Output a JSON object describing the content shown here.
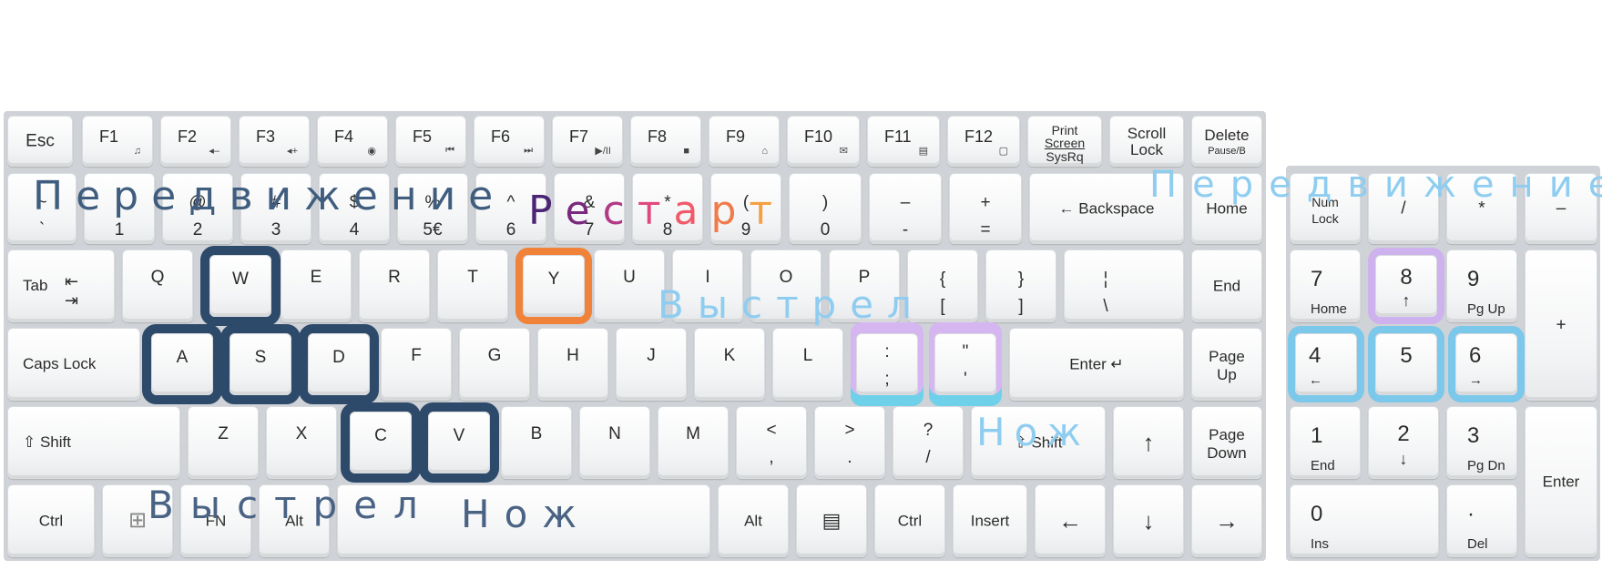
{
  "keyboard": {
    "fn_row": {
      "esc": "Esc",
      "f1": "F1",
      "f1_icon": "♫",
      "f2": "F2",
      "f2_icon": "◂–",
      "f3": "F3",
      "f3_icon": "◂+",
      "f4": "F4",
      "f4_icon": "◉",
      "f5": "F5",
      "f5_icon": "⏮",
      "f6": "F6",
      "f6_icon": "⏭",
      "f7": "F7",
      "f7_icon": "▶/II",
      "f8": "F8",
      "f8_icon": "■",
      "f9": "F9",
      "f9_icon": "⌂",
      "f10": "F10",
      "f10_icon": "✉",
      "f11": "F11",
      "f11_icon": "▤",
      "f12": "F12",
      "f12_icon": "▢",
      "print_screen_1": "Print",
      "print_screen_2": "Screen",
      "print_screen_3": "SysRq",
      "scroll_lock_1": "Scroll",
      "scroll_lock_2": "Lock",
      "delete": "Delete",
      "delete_alt": "Pause/B"
    },
    "num_row": {
      "tilde_top": "~",
      "tilde_bot": "`",
      "k1_top": "!",
      "k1_bot": "1",
      "k2_top": "@",
      "k2_bot": "2",
      "k3_top": "#",
      "k3_bot": "3",
      "k4_top": "$",
      "k4_bot": "4",
      "k5_top": "%",
      "k5_bot": "5€",
      "k6_top": "^",
      "k6_bot": "6",
      "k7_top": "&",
      "k7_bot": "7",
      "k8_top": "*",
      "k8_bot": "8",
      "k9_top": "(",
      "k9_bot": "9",
      "k0_top": ")",
      "k0_bot": "0",
      "minus_top": "–",
      "minus_bot": "-",
      "plus_top": "+",
      "plus_bot": "=",
      "backspace": "← Backspace",
      "home": "Home"
    },
    "top_row": {
      "tab": "Tab",
      "q": "Q",
      "w": "W",
      "e": "E",
      "r": "R",
      "t": "T",
      "y": "Y",
      "u": "U",
      "i": "I",
      "o": "O",
      "p": "P",
      "lbrace_top": "{",
      "lbrace_bot": "[",
      "rbrace_top": "}",
      "rbrace_bot": "]",
      "pipe_top": "¦",
      "pipe_bot": "\\",
      "end": "End"
    },
    "home_row": {
      "caps": "Caps Lock",
      "a": "A",
      "s": "S",
      "d": "D",
      "f": "F",
      "g": "G",
      "h": "H",
      "j": "J",
      "k": "K",
      "l": "L",
      "colon_top": ":",
      "colon_bot": ";",
      "quote_top": "\"",
      "quote_bot": "'",
      "enter": "Enter ↵",
      "pgup_1": "Page",
      "pgup_2": "Up"
    },
    "shift_row": {
      "shift_l": "⇧ Shift",
      "z": "Z",
      "x": "X",
      "c": "C",
      "v": "V",
      "b": "B",
      "n": "N",
      "m": "M",
      "lt_top": "<",
      "lt_bot": ",",
      "gt_top": ">",
      "gt_bot": ".",
      "q_top": "?",
      "q_bot": "/",
      "shift_r": "⇧ Shift",
      "up": "↑",
      "pgdn_1": "Page",
      "pgdn_2": "Down"
    },
    "bottom_row": {
      "ctrl_l": "Ctrl",
      "win": "⊞",
      "fn": "FN",
      "alt_l": "Alt",
      "alt_r": "Alt",
      "menu": "▤",
      "ctrl_r": "Ctrl",
      "insert": "Insert",
      "left": "←",
      "down": "↓",
      "right": "→"
    },
    "numpad": {
      "numlock_1": "Num",
      "numlock_2": "Lock",
      "slash": "/",
      "star": "*",
      "minus": "–",
      "n7": "7",
      "n7_alt": "Home",
      "n8": "8",
      "n8_alt": "↑",
      "n9": "9",
      "n9_alt": "Pg Up",
      "plus": "+",
      "n4": "4",
      "n4_alt": "←",
      "n5": "5",
      "n6": "6",
      "n6_alt": "→",
      "n1": "1",
      "n1_alt": "End",
      "n2": "2",
      "n2_alt": "↓",
      "n3": "3",
      "n3_alt": "Pg Dn",
      "enter": "Enter",
      "n0": "0",
      "n0_alt": "Ins",
      "dot": "·",
      "dot_alt": "Del"
    }
  },
  "overlays": {
    "move_left": "Передвижение",
    "restart": [
      "Р",
      "е",
      "с",
      "т",
      "а",
      "р",
      "т"
    ],
    "move_right": "Передвижение",
    "shoot_top": "Выстрел",
    "knife_right": "Нож",
    "shoot_bottom": "Выстрел",
    "knife_bottom": "Нож"
  },
  "colors": {
    "movement_dark": "#2e4a6b",
    "restart_orange": "#f0823a",
    "shoot_blue": "#7cc8ea",
    "knife_lilac": "#cdb2ee"
  }
}
